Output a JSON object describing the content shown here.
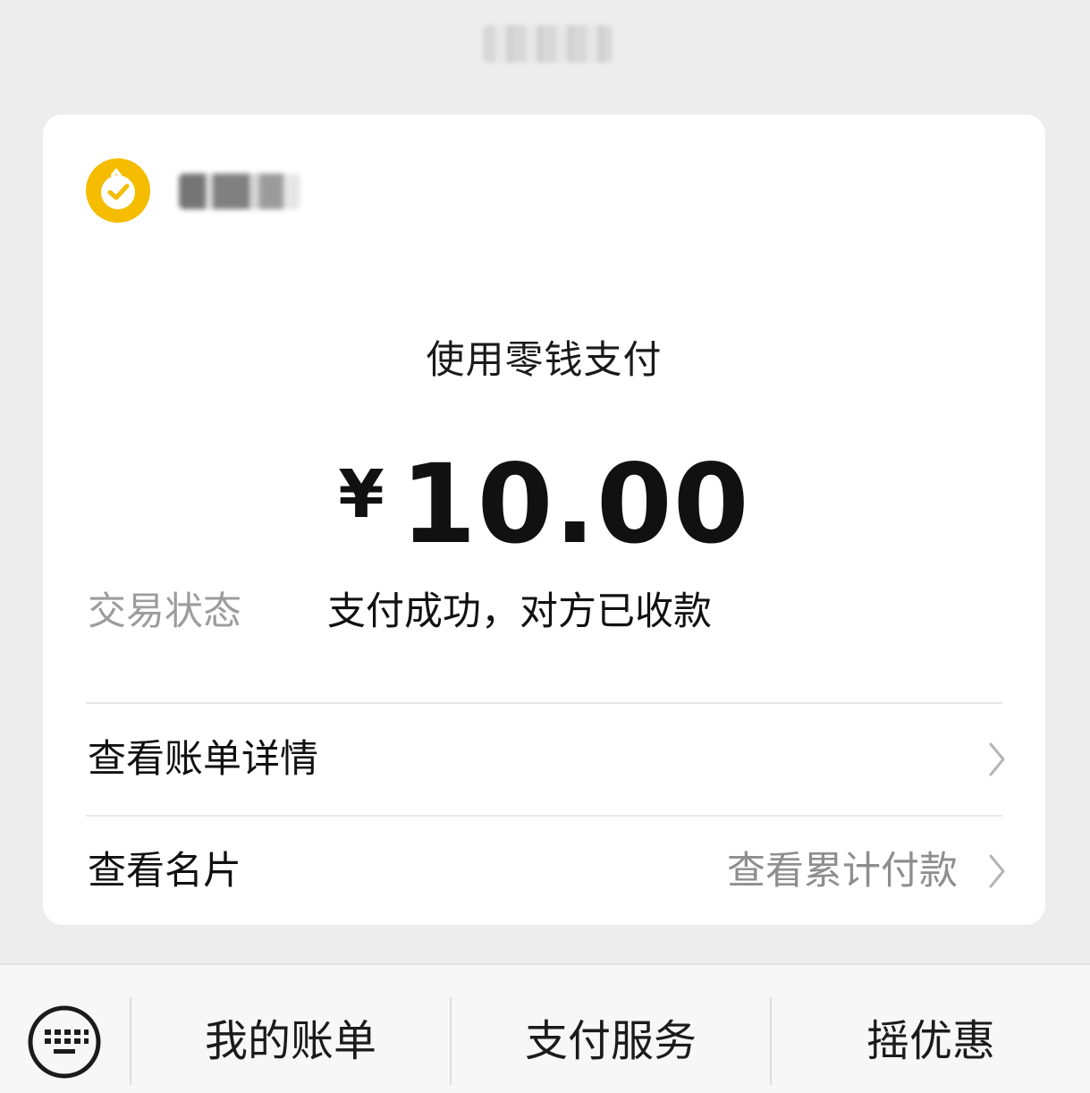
{
  "header": {
    "title": ""
  },
  "merchant": {
    "name": "",
    "logo_icon": "merchant-logo-icon",
    "logo_color": "#f5bc00"
  },
  "payment": {
    "method": "使用零钱支付",
    "currency": "¥",
    "amount": "10.00",
    "status_label": "交易状态",
    "status_value": "支付成功，对方已收款"
  },
  "rows": [
    {
      "label": "查看账单详情",
      "value": "",
      "icon": "chevron-right-icon"
    },
    {
      "label": "查看名片",
      "value": "查看累计付款",
      "icon": "chevron-right-icon"
    }
  ],
  "bottom_menu": {
    "keyboard_icon": "keyboard-icon",
    "items": [
      {
        "label": "我的账单"
      },
      {
        "label": "支付服务"
      },
      {
        "label": "摇优惠"
      }
    ]
  }
}
